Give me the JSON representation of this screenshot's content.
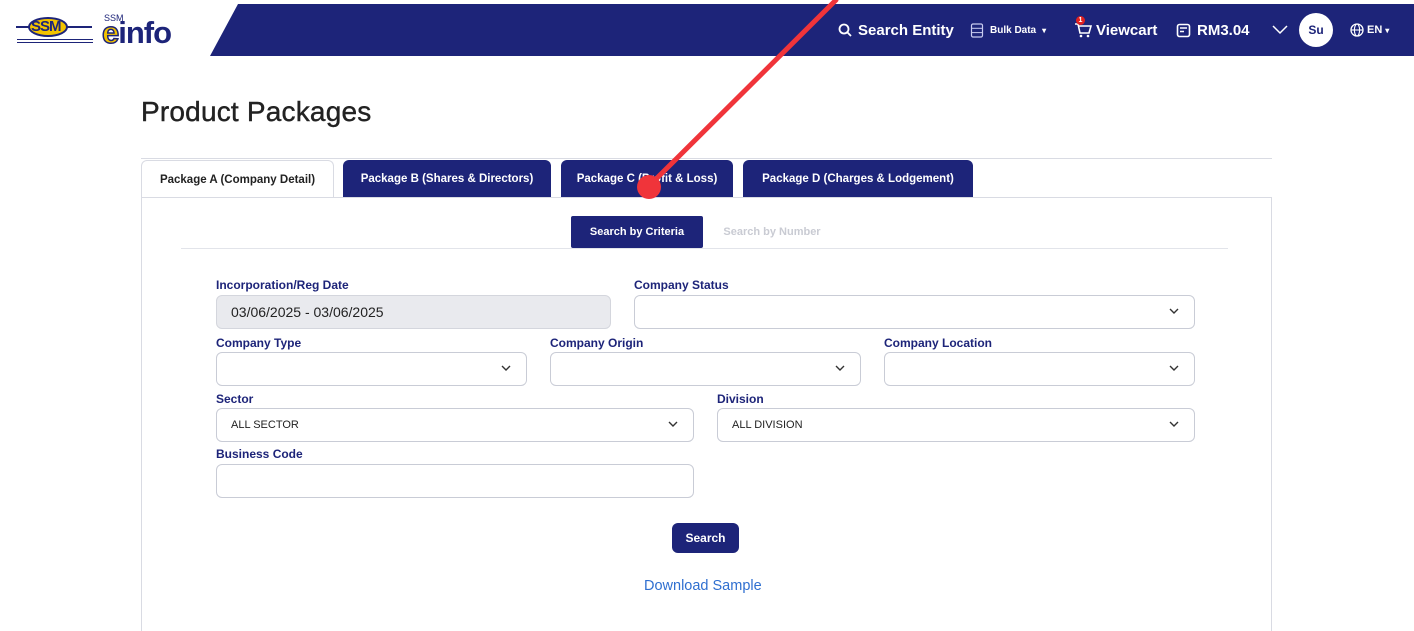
{
  "header": {
    "logo_ssm": "SSM",
    "logo_ssm_small": "SSM",
    "logo_einfo_e": "e",
    "logo_einfo_rest": "info",
    "search_label": "Search Entity",
    "bulk_label": "Bulk Data",
    "cart_label": "Viewcart",
    "cart_count": "1",
    "balance": "RM3.04",
    "avatar_initials": "Su",
    "language": "EN"
  },
  "page": {
    "title": "Product Packages"
  },
  "tabs": [
    {
      "label": "Package A (Company Detail)"
    },
    {
      "label": "Package B (Shares & Directors)"
    },
    {
      "label": "Package C (Profit & Loss)"
    },
    {
      "label": "Package D (Charges & Lodgement)"
    }
  ],
  "subtabs": {
    "criteria": "Search by Criteria",
    "number": "Search by Number"
  },
  "form": {
    "reg_date_label": "Incorporation/Reg Date",
    "reg_date_value": "03/06/2025 - 03/06/2025",
    "status_label": "Company Status",
    "status_value": "",
    "type_label": "Company Type",
    "type_value": "",
    "origin_label": "Company Origin",
    "origin_value": "",
    "location_label": "Company Location",
    "location_value": "",
    "sector_label": "Sector",
    "sector_value": "ALL SECTOR",
    "division_label": "Division",
    "division_value": "ALL DIVISION",
    "business_code_label": "Business Code",
    "business_code_value": "",
    "search_button": "Search",
    "download_link": "Download Sample"
  },
  "colors": {
    "navy": "#1d2479",
    "accent_yellow": "#f2c300",
    "link": "#2f6fd0",
    "annotation": "#f0343a"
  }
}
